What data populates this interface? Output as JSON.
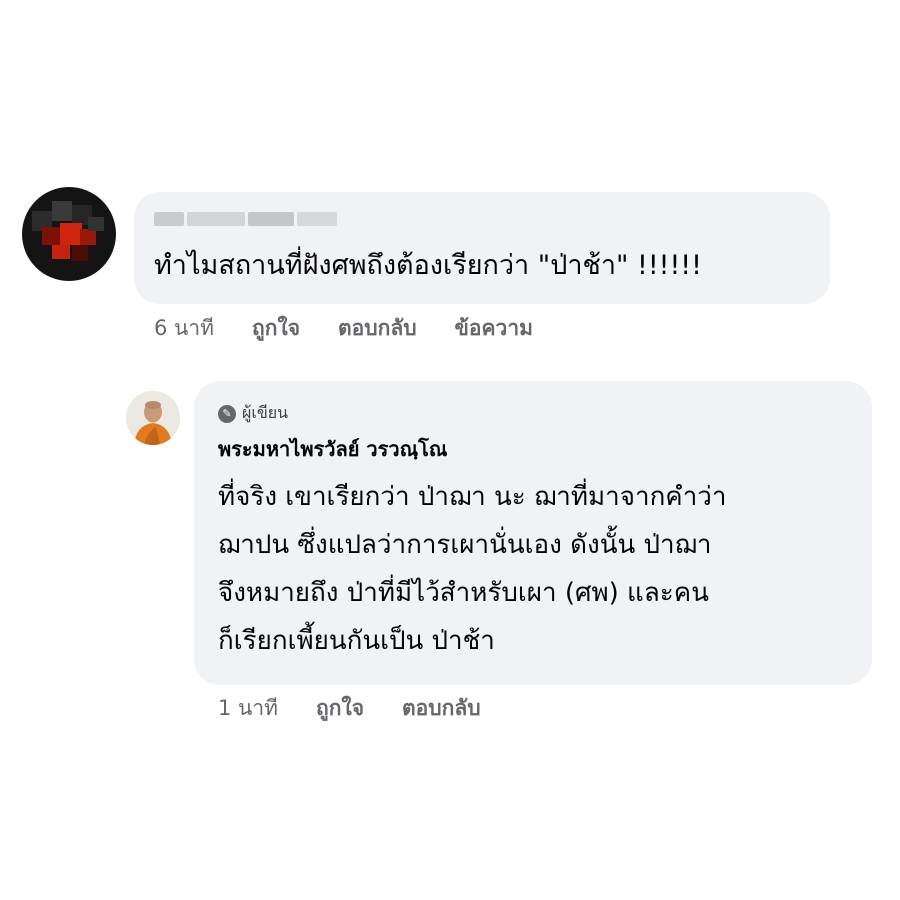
{
  "comments": [
    {
      "author": "",
      "text": "ทำไมสถานที่ฝังศพถึงต้องเรียกว่า \"ป่าช้า\" !!!!!!",
      "time": "6 นาที",
      "actions": {
        "like": "ถูกใจ",
        "reply": "ตอบกลับ",
        "message": "ข้อความ"
      },
      "avatar_icon": "pixelated-avatar"
    }
  ],
  "reply": {
    "badge_label": "ผู้เขียน",
    "badge_icon": "pen-icon",
    "author": "พระมหาไพรวัลย์ วรวณฺโณ",
    "lines": [
      "ที่จริง เขาเรียกว่า ป่าฌา นะ ฌาที่มาจากคำว่า",
      "ฌาปน ซึ่งแปลว่าการเผานั่นเอง ดังนั้น ป่าฌา",
      "จึงหมายถึง ป่าที่มีไว้สำหรับเผา (ศพ) และคน",
      "ก็เรียกเพี้ยนกันเป็น ป่าช้า"
    ],
    "time": "1 นาที",
    "actions": {
      "like": "ถูกใจ",
      "reply": "ตอบกลับ"
    }
  },
  "colors": {
    "bubble": "#f0f2f5",
    "secondary_text": "#65676b",
    "primary_text": "#050505",
    "robe": "#e07b1f"
  }
}
